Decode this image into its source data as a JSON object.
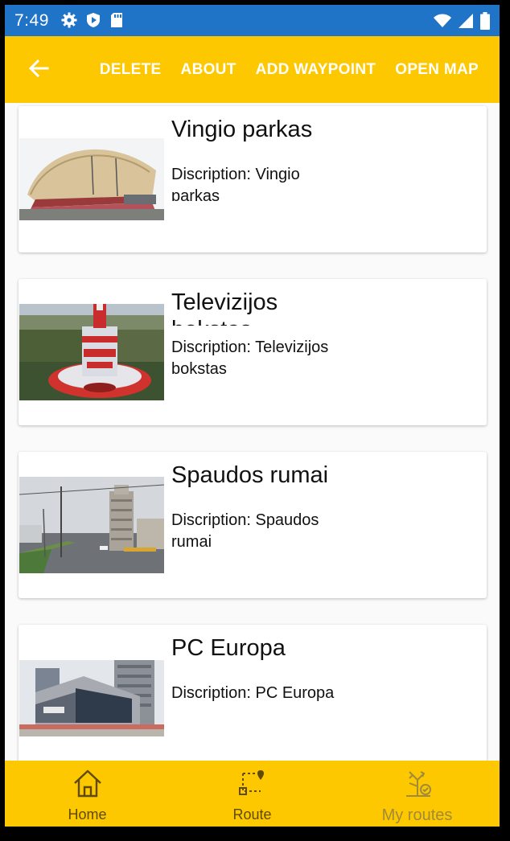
{
  "status_bar": {
    "time": "7:49",
    "left_icons": [
      "gear-icon",
      "shield-play-icon",
      "sd-card-icon"
    ],
    "right_icons": [
      "wifi-icon",
      "signal-icon",
      "battery-icon"
    ]
  },
  "app_bar": {
    "back_icon": "arrow-left-icon",
    "actions": [
      "DELETE",
      "ABOUT",
      "ADD WAYPOINT",
      "OPEN MAP"
    ]
  },
  "waypoints": [
    {
      "title": "Vingio parkas",
      "description": "Discription: Vingio parkas"
    },
    {
      "title": "Televizijos bokstas",
      "description": "Discription: Televizijos bokstas"
    },
    {
      "title": "Spaudos rumai",
      "description": "Discription: Spaudos rumai"
    },
    {
      "title": "PC Europa",
      "description": "Discription: PC Europa"
    }
  ],
  "bottom_nav": {
    "items": [
      {
        "label": "Home",
        "icon": "home-icon"
      },
      {
        "label": "Route",
        "icon": "route-icon"
      },
      {
        "label": "My routes",
        "icon": "my-routes-icon"
      }
    ]
  },
  "colors": {
    "status_bar": "#1f74c8",
    "accent": "#fdc800",
    "nav_active": "#5e4a00",
    "nav_inactive": "#a08a3c"
  }
}
